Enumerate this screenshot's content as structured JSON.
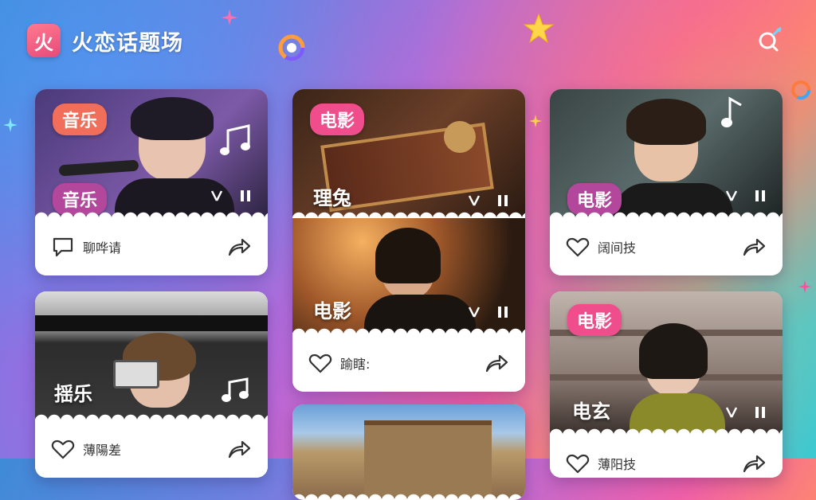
{
  "app": {
    "logo_char": "火",
    "title": "火恋话题场"
  },
  "colors": {
    "tag_orange": "#f06e5a",
    "tag_purple": "#b2479c",
    "tag_pink": "#ef4d8c"
  },
  "cards": [
    {
      "tag_top": "音乐",
      "tag_bottom": "音乐",
      "footer_label": "聊哗请"
    },
    {
      "tag_top": "电影",
      "overlay_text": "理兔"
    },
    {
      "overlay_text": "电影",
      "footer_label": "踰瞎:"
    },
    {
      "tag": "电影",
      "footer_label": "阔间技"
    },
    {
      "overlay_text": "揺乐",
      "footer_label": "薄陽差"
    },
    {
      "tag": "电影",
      "overlay_text": "电玄",
      "footer_label": "薄阳技"
    }
  ]
}
